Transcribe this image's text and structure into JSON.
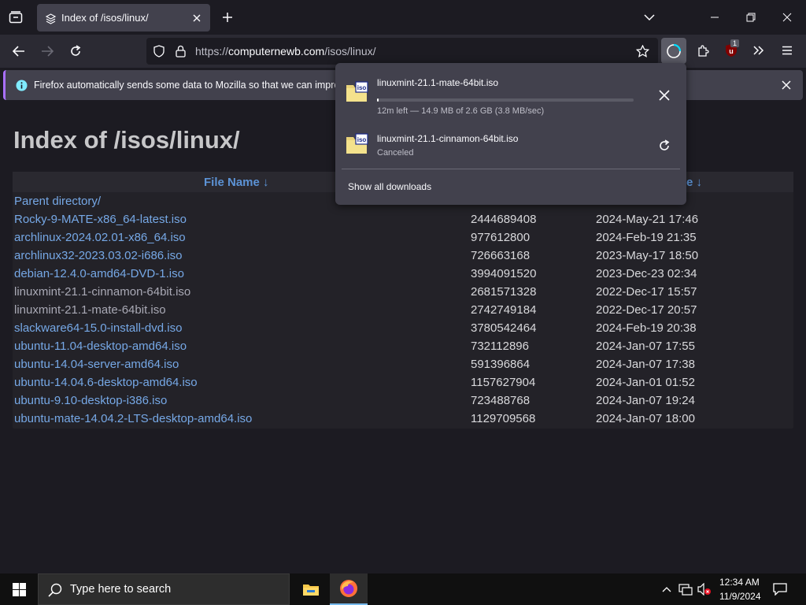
{
  "tab": {
    "title": "Index of /isos/linux/"
  },
  "navbar": {
    "url_prefix": "https://",
    "url_host": "computernewb.com",
    "url_path": "/isos/linux/",
    "extension_badge": "1"
  },
  "notification": {
    "text": "Firefox automatically sends some data to Mozilla so that we can improve"
  },
  "page": {
    "title": "Index of /isos/linux/",
    "headers": {
      "name": "File Name  ↓",
      "date": "te  ↓"
    },
    "parent": "Parent directory/",
    "rows": [
      {
        "name": "Rocky-9-MATE-x86_64-latest.iso",
        "size": "2444689408",
        "date": "2024-May-21 17:46",
        "visited": false
      },
      {
        "name": "archlinux-2024.02.01-x86_64.iso",
        "size": "977612800",
        "date": "2024-Feb-19 21:35",
        "visited": false
      },
      {
        "name": "archlinux32-2023.03.02-i686.iso",
        "size": "726663168",
        "date": "2023-May-17 18:50",
        "visited": false
      },
      {
        "name": "debian-12.4.0-amd64-DVD-1.iso",
        "size": "3994091520",
        "date": "2023-Dec-23 02:34",
        "visited": false
      },
      {
        "name": "linuxmint-21.1-cinnamon-64bit.iso",
        "size": "2681571328",
        "date": "2022-Dec-17 15:57",
        "visited": true
      },
      {
        "name": "linuxmint-21.1-mate-64bit.iso",
        "size": "2742749184",
        "date": "2022-Dec-17 20:57",
        "visited": true
      },
      {
        "name": "slackware64-15.0-install-dvd.iso",
        "size": "3780542464",
        "date": "2024-Feb-19 20:38",
        "visited": false
      },
      {
        "name": "ubuntu-11.04-desktop-amd64.iso",
        "size": "732112896",
        "date": "2024-Jan-07 17:55",
        "visited": false
      },
      {
        "name": "ubuntu-14.04-server-amd64.iso",
        "size": "591396864",
        "date": "2024-Jan-07 17:38",
        "visited": false
      },
      {
        "name": "ubuntu-14.04.6-desktop-amd64.iso",
        "size": "1157627904",
        "date": "2024-Jan-01 01:52",
        "visited": false
      },
      {
        "name": "ubuntu-9.10-desktop-i386.iso",
        "size": "723488768",
        "date": "2024-Jan-07 19:24",
        "visited": false
      },
      {
        "name": "ubuntu-mate-14.04.2-LTS-desktop-amd64.iso",
        "size": "1129709568",
        "date": "2024-Jan-07 18:00",
        "visited": false
      }
    ]
  },
  "downloads": {
    "items": [
      {
        "name": "linuxmint-21.1-mate-64bit.iso",
        "status": "12m left — 14.9 MB of 2.6 GB (3.8 MB/sec)",
        "progress": 0.0057
      },
      {
        "name": "linuxmint-21.1-cinnamon-64bit.iso",
        "status": "Canceled"
      }
    ],
    "show_all": "Show all downloads"
  },
  "taskbar": {
    "search_placeholder": "Type here to search",
    "time": "12:34 AM",
    "date": "11/9/2024"
  }
}
